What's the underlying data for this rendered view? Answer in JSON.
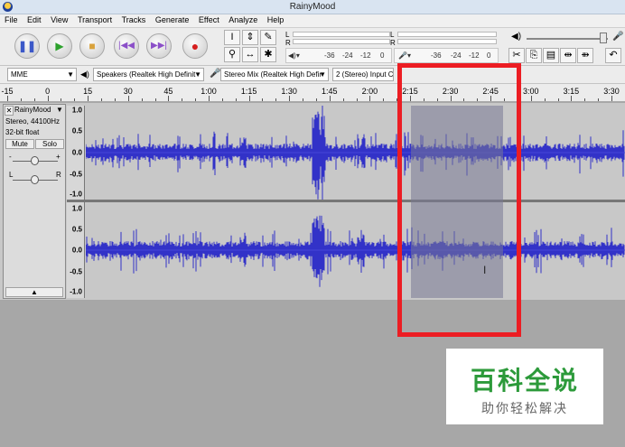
{
  "window": {
    "title": "RainyMood"
  },
  "menu": [
    "File",
    "Edit",
    "View",
    "Transport",
    "Tracks",
    "Generate",
    "Effect",
    "Analyze",
    "Help"
  ],
  "meters": {
    "record_channels": [
      "L",
      "R"
    ],
    "play_channels": [
      "L",
      "R"
    ],
    "record_scale": [
      "-36",
      "-24",
      "-12",
      "0"
    ],
    "play_scale": [
      "-36",
      "-24",
      "-12",
      "0"
    ]
  },
  "devices": {
    "host": "MME",
    "output": "Speakers (Realtek High Definit",
    "input": "Stereo Mix (Realtek High Defir",
    "channels": "2 (Stereo) Input C"
  },
  "ruler": {
    "labels": [
      "-15",
      "0",
      "15",
      "30",
      "45",
      "1:00",
      "1:15",
      "1:30",
      "1:45",
      "2:00",
      "2:15",
      "2:30",
      "2:45",
      "3:00",
      "3:15",
      "3:30"
    ]
  },
  "track": {
    "name": "RainyMood",
    "rate": "Stereo, 44100Hz",
    "format": "32-bit float",
    "mute": "Mute",
    "solo": "Solo",
    "gain_minus": "-",
    "gain_plus": "+",
    "pan_left": "L",
    "pan_right": "R",
    "close": "✕",
    "menu_arrow": "▼",
    "collapse": "▲",
    "scale": [
      "1.0",
      "0.5",
      "0.0",
      "-0.5",
      "-1.0"
    ]
  },
  "selection": {
    "start": "2:15",
    "end": "2:46"
  },
  "watermark": {
    "title": "百科全说",
    "subtitle": "助你轻松解决"
  },
  "colors": {
    "waveform": "#3232c8",
    "selection": "#78789a",
    "highlight_box": "#ec1d23",
    "play": "#2ea22e",
    "record": "#d61f1f"
  }
}
